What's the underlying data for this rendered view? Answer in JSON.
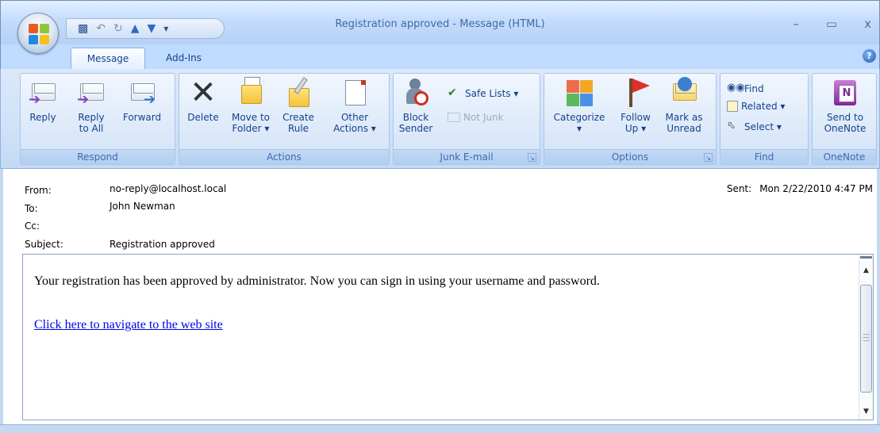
{
  "window": {
    "title": "Registration approved - Message (HTML)",
    "minimize": "–",
    "maximize": "▭",
    "close": "x"
  },
  "qat": {
    "save_icon": "save-icon",
    "undo_icon": "undo-icon",
    "redo_icon": "redo-icon",
    "up_icon": "previous-item-icon",
    "down_icon": "next-item-icon",
    "customize": "▾"
  },
  "tabs": [
    {
      "label": "Message"
    },
    {
      "label": "Add-Ins"
    }
  ],
  "ribbon": {
    "respond": {
      "label": "Respond",
      "reply": "Reply",
      "reply_all_1": "Reply",
      "reply_all_2": "to All",
      "forward": "Forward"
    },
    "actions": {
      "label": "Actions",
      "delete": "Delete",
      "move_1": "Move to",
      "move_2": "Folder ▾",
      "rule_1": "Create",
      "rule_2": "Rule",
      "other_1": "Other",
      "other_2": "Actions ▾"
    },
    "junk": {
      "label": "Junk E-mail",
      "block_1": "Block",
      "block_2": "Sender",
      "safe_lists": "Safe Lists ▾",
      "not_junk": "Not Junk"
    },
    "options": {
      "label": "Options",
      "categorize_1": "Categorize",
      "categorize_2": "▾",
      "follow_1": "Follow",
      "follow_2": "Up ▾",
      "mark_1": "Mark as",
      "mark_2": "Unread"
    },
    "find": {
      "label": "Find",
      "find": "Find",
      "related": "Related ▾",
      "select": "Select ▾"
    },
    "onenote": {
      "label": "OneNote",
      "send_1": "Send to",
      "send_2": "OneNote"
    }
  },
  "header": {
    "from_label": "From:",
    "from_value": "no-reply@localhost.local",
    "to_label": "To:",
    "to_value": "John Newman",
    "cc_label": "Cc:",
    "cc_value": "",
    "subject_label": "Subject:",
    "subject_value": "Registration approved",
    "sent_label": "Sent:",
    "sent_value": "Mon 2/22/2010 4:47 PM"
  },
  "body": {
    "text": "Your registration has been approved by administrator. Now you can sign in using your username and password.",
    "link": "Click here to navigate to the web site"
  },
  "colors": {
    "ribbon_text": "#15428b",
    "link": "#0000ee"
  }
}
